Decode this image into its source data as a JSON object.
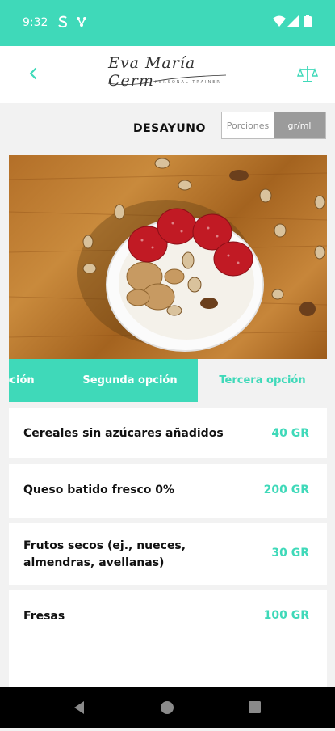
{
  "status_bar": {
    "time": "9:32",
    "icons": [
      "s-icon",
      "nfc-icon",
      "wifi-icon",
      "signal-icon",
      "battery-icon"
    ]
  },
  "header": {
    "logo_script": "Eva María Cerm",
    "logo_subtitle": "PERSONAL TRAINER",
    "back_icon": "chevron-left-icon",
    "right_icon": "scale-icon"
  },
  "meal": {
    "title": "DESAYUNO",
    "unit_toggle": {
      "options": [
        "Porciones",
        "gr/ml"
      ],
      "selected": "gr/ml"
    }
  },
  "tabs": [
    "pción",
    "Segunda opción",
    "Tercera opción"
  ],
  "ingredients": [
    {
      "name": "Cereales sin azúcares añadidos",
      "amount": "40 GR"
    },
    {
      "name": "Queso batido fresco 0%",
      "amount": "200 GR"
    },
    {
      "name": "Frutos secos (ej., nueces, almendras, avellanas)",
      "amount": "30 GR"
    },
    {
      "name": "Fresas",
      "amount": "100 GR"
    }
  ],
  "colors": {
    "accent": "#3fd9b9",
    "toggle_active": "#9b9b9b",
    "background": "#f2f2f2"
  }
}
